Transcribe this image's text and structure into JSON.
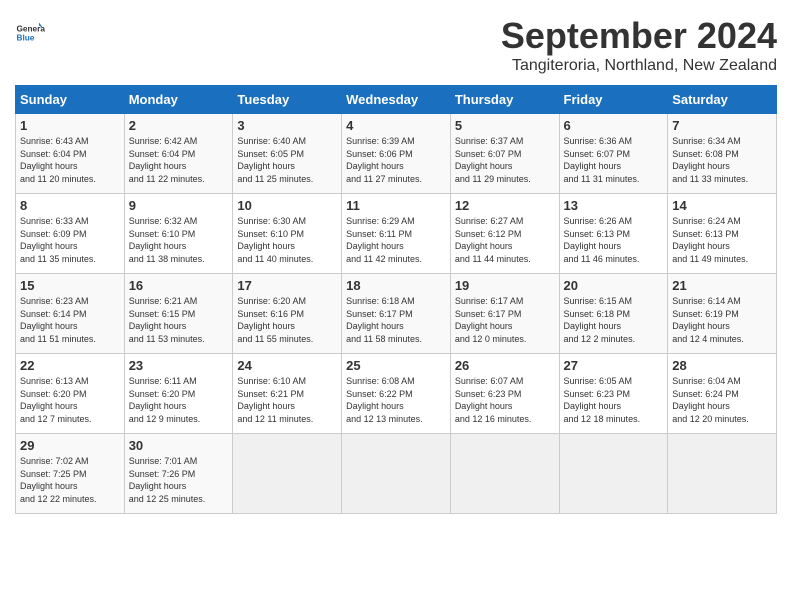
{
  "header": {
    "logo_text_general": "General",
    "logo_text_blue": "Blue",
    "month_title": "September 2024",
    "location": "Tangiteroria, Northland, New Zealand"
  },
  "weekdays": [
    "Sunday",
    "Monday",
    "Tuesday",
    "Wednesday",
    "Thursday",
    "Friday",
    "Saturday"
  ],
  "weeks": [
    [
      {
        "day": "1",
        "sunrise": "6:43 AM",
        "sunset": "6:04 PM",
        "daylight": "11 hours and 20 minutes."
      },
      {
        "day": "2",
        "sunrise": "6:42 AM",
        "sunset": "6:04 PM",
        "daylight": "11 hours and 22 minutes."
      },
      {
        "day": "3",
        "sunrise": "6:40 AM",
        "sunset": "6:05 PM",
        "daylight": "11 hours and 25 minutes."
      },
      {
        "day": "4",
        "sunrise": "6:39 AM",
        "sunset": "6:06 PM",
        "daylight": "11 hours and 27 minutes."
      },
      {
        "day": "5",
        "sunrise": "6:37 AM",
        "sunset": "6:07 PM",
        "daylight": "11 hours and 29 minutes."
      },
      {
        "day": "6",
        "sunrise": "6:36 AM",
        "sunset": "6:07 PM",
        "daylight": "11 hours and 31 minutes."
      },
      {
        "day": "7",
        "sunrise": "6:34 AM",
        "sunset": "6:08 PM",
        "daylight": "11 hours and 33 minutes."
      }
    ],
    [
      {
        "day": "8",
        "sunrise": "6:33 AM",
        "sunset": "6:09 PM",
        "daylight": "11 hours and 35 minutes."
      },
      {
        "day": "9",
        "sunrise": "6:32 AM",
        "sunset": "6:10 PM",
        "daylight": "11 hours and 38 minutes."
      },
      {
        "day": "10",
        "sunrise": "6:30 AM",
        "sunset": "6:10 PM",
        "daylight": "11 hours and 40 minutes."
      },
      {
        "day": "11",
        "sunrise": "6:29 AM",
        "sunset": "6:11 PM",
        "daylight": "11 hours and 42 minutes."
      },
      {
        "day": "12",
        "sunrise": "6:27 AM",
        "sunset": "6:12 PM",
        "daylight": "11 hours and 44 minutes."
      },
      {
        "day": "13",
        "sunrise": "6:26 AM",
        "sunset": "6:13 PM",
        "daylight": "11 hours and 46 minutes."
      },
      {
        "day": "14",
        "sunrise": "6:24 AM",
        "sunset": "6:13 PM",
        "daylight": "11 hours and 49 minutes."
      }
    ],
    [
      {
        "day": "15",
        "sunrise": "6:23 AM",
        "sunset": "6:14 PM",
        "daylight": "11 hours and 51 minutes."
      },
      {
        "day": "16",
        "sunrise": "6:21 AM",
        "sunset": "6:15 PM",
        "daylight": "11 hours and 53 minutes."
      },
      {
        "day": "17",
        "sunrise": "6:20 AM",
        "sunset": "6:16 PM",
        "daylight": "11 hours and 55 minutes."
      },
      {
        "day": "18",
        "sunrise": "6:18 AM",
        "sunset": "6:17 PM",
        "daylight": "11 hours and 58 minutes."
      },
      {
        "day": "19",
        "sunrise": "6:17 AM",
        "sunset": "6:17 PM",
        "daylight": "12 hours and 0 minutes."
      },
      {
        "day": "20",
        "sunrise": "6:15 AM",
        "sunset": "6:18 PM",
        "daylight": "12 hours and 2 minutes."
      },
      {
        "day": "21",
        "sunrise": "6:14 AM",
        "sunset": "6:19 PM",
        "daylight": "12 hours and 4 minutes."
      }
    ],
    [
      {
        "day": "22",
        "sunrise": "6:13 AM",
        "sunset": "6:20 PM",
        "daylight": "12 hours and 7 minutes."
      },
      {
        "day": "23",
        "sunrise": "6:11 AM",
        "sunset": "6:20 PM",
        "daylight": "12 hours and 9 minutes."
      },
      {
        "day": "24",
        "sunrise": "6:10 AM",
        "sunset": "6:21 PM",
        "daylight": "12 hours and 11 minutes."
      },
      {
        "day": "25",
        "sunrise": "6:08 AM",
        "sunset": "6:22 PM",
        "daylight": "12 hours and 13 minutes."
      },
      {
        "day": "26",
        "sunrise": "6:07 AM",
        "sunset": "6:23 PM",
        "daylight": "12 hours and 16 minutes."
      },
      {
        "day": "27",
        "sunrise": "6:05 AM",
        "sunset": "6:23 PM",
        "daylight": "12 hours and 18 minutes."
      },
      {
        "day": "28",
        "sunrise": "6:04 AM",
        "sunset": "6:24 PM",
        "daylight": "12 hours and 20 minutes."
      }
    ],
    [
      {
        "day": "29",
        "sunrise": "7:02 AM",
        "sunset": "7:25 PM",
        "daylight": "12 hours and 22 minutes."
      },
      {
        "day": "30",
        "sunrise": "7:01 AM",
        "sunset": "7:26 PM",
        "daylight": "12 hours and 25 minutes."
      },
      null,
      null,
      null,
      null,
      null
    ]
  ]
}
